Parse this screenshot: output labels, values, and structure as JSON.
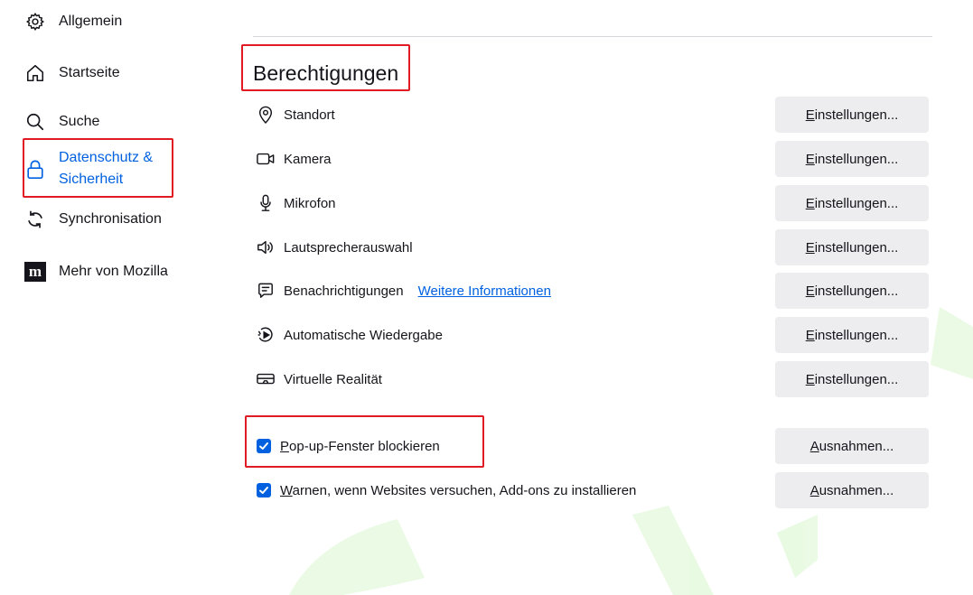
{
  "sidebar": {
    "items": [
      {
        "label": "Allgemein",
        "icon": "gear-icon"
      },
      {
        "label": "Startseite",
        "icon": "home-icon"
      },
      {
        "label": "Suche",
        "icon": "search-icon"
      },
      {
        "label_line1": "Datenschutz &",
        "label_line2": "Sicherheit",
        "icon": "lock-icon",
        "active": true
      },
      {
        "label": "Synchronisation",
        "icon": "sync-icon"
      },
      {
        "label": "Mehr von Mozilla",
        "icon": "mozilla-icon"
      }
    ]
  },
  "permissions": {
    "title": "Berechtigungen",
    "rows": [
      {
        "label": "Standort",
        "icon": "location-icon",
        "button_key": "E",
        "button_rest": "instellungen..."
      },
      {
        "label": "Kamera",
        "icon": "camera-icon",
        "button_key": "E",
        "button_rest": "instellungen..."
      },
      {
        "label": "Mikrofon",
        "icon": "microphone-icon",
        "button_key": "E",
        "button_rest": "instellungen..."
      },
      {
        "label": "Lautsprecherauswahl",
        "icon": "speaker-icon",
        "button_key": "E",
        "button_rest": "instellungen..."
      },
      {
        "label": "Benachrichtigungen",
        "icon": "notification-icon",
        "link": "Weitere Informationen",
        "button_key": "E",
        "button_rest": "instellungen..."
      },
      {
        "label": "Automatische Wiedergabe",
        "icon": "autoplay-icon",
        "button_key": "E",
        "button_rest": "instellungen..."
      },
      {
        "label": "Virtuelle Realität",
        "icon": "vr-icon",
        "button_key": "E",
        "button_rest": "instellungen..."
      }
    ],
    "checkboxes": [
      {
        "key": "P",
        "rest": "op-up-Fenster blockieren",
        "checked": true,
        "button_key": "A",
        "button_rest": "usnahmen..."
      },
      {
        "key": "W",
        "rest": "arnen, wenn Websites versuchen, Add-ons zu installieren",
        "checked": true,
        "button_key": "A",
        "button_rest": "usnahmen..."
      }
    ]
  },
  "colors": {
    "accent": "#0061e0",
    "highlight": "#e01b24",
    "button_bg": "#ededf0",
    "watermark": "#7fe04a"
  }
}
